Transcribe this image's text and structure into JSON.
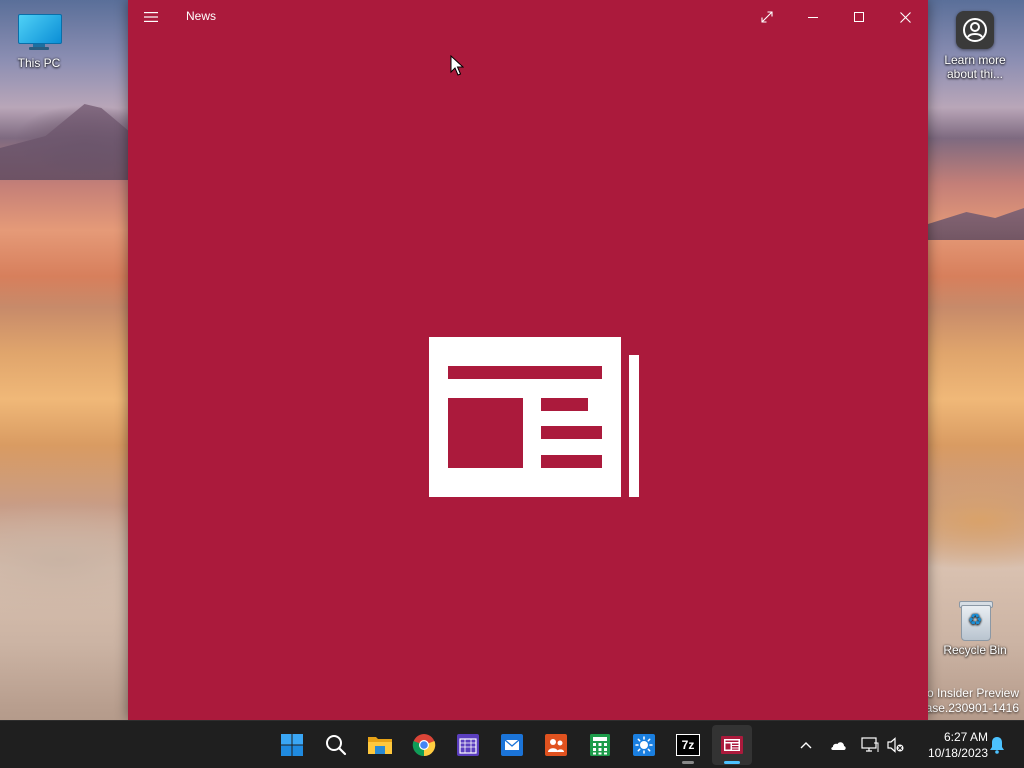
{
  "desktop": {
    "icons": [
      {
        "label": "This PC",
        "icon": "monitor-icon"
      },
      {
        "label": "Learn more about thi...",
        "icon": "learn-more-icon"
      },
      {
        "label": "Recycle Bin",
        "icon": "recycle-bin-icon"
      }
    ],
    "watermark": {
      "line1": "o Insider Preview",
      "line2": "ease.230901-1416"
    }
  },
  "window": {
    "title": "News",
    "accent_color": "#ab1a3c",
    "buttons": {
      "menu": "hamburger-icon",
      "full_screen": "expand-icon",
      "minimize": "minimize-icon",
      "maximize": "maximize-icon",
      "close": "close-icon"
    },
    "splash_icon": "newspaper-icon"
  },
  "taskbar": {
    "apps": [
      {
        "name": "Start",
        "icon": "windows-start-icon",
        "active": false,
        "running": false
      },
      {
        "name": "Search",
        "icon": "search-icon",
        "active": false,
        "running": false
      },
      {
        "name": "File Explorer",
        "icon": "folder-icon",
        "active": false,
        "running": false
      },
      {
        "name": "Google Chrome",
        "icon": "chrome-icon",
        "active": false,
        "running": false
      },
      {
        "name": "Calendar",
        "icon": "calendar-icon",
        "active": false,
        "running": false
      },
      {
        "name": "Mail",
        "icon": "mail-icon",
        "active": false,
        "running": false
      },
      {
        "name": "People",
        "icon": "people-icon",
        "active": false,
        "running": false
      },
      {
        "name": "Calculator",
        "icon": "calculator-icon",
        "active": false,
        "running": false
      },
      {
        "name": "Weather",
        "icon": "weather-icon",
        "active": false,
        "running": false
      },
      {
        "name": "7-Zip",
        "icon": "7zip-icon",
        "label": "7z",
        "active": false,
        "running": true
      },
      {
        "name": "News",
        "icon": "news-icon",
        "active": true,
        "running": true
      }
    ],
    "tray": {
      "icons": [
        "chevron-up-icon",
        "onedrive-cloud-icon",
        "network-icon",
        "volume-muted-icon"
      ],
      "time": "6:27 AM",
      "date": "10/18/2023",
      "notification_icon": "notification-bell-icon"
    }
  }
}
